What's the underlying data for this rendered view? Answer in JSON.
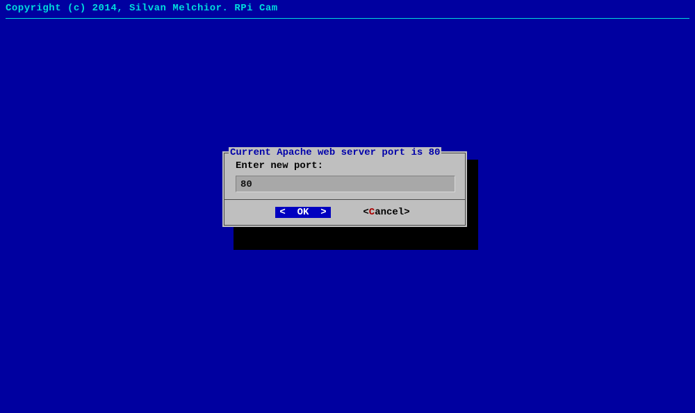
{
  "header": {
    "copyright": "Copyright (c) 2014, Silvan Melchior. RPi Cam"
  },
  "dialog": {
    "title": "Current Apache web server port is 80",
    "prompt": "Enter new port:",
    "input_value": "80",
    "ok_lt": "<",
    "ok_label": "OK",
    "ok_gt": ">",
    "cancel_lt": "<",
    "cancel_hotkey": "C",
    "cancel_rest": "ancel",
    "cancel_gt": ">"
  }
}
